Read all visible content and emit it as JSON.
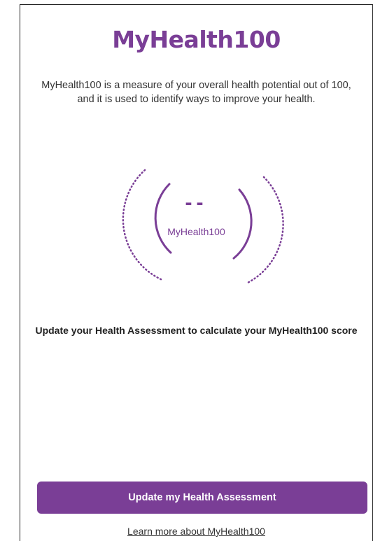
{
  "brand": {
    "title": "MyHealth100",
    "accent": "#7a3e96"
  },
  "intro": {
    "description": "MyHealth100 is a measure of your overall health potential out of 100, and it is used to identify ways to improve your health."
  },
  "score": {
    "value": "--",
    "label": "MyHealth100"
  },
  "prompt": {
    "text": "Update your Health Assessment to calculate your MyHealth100 score"
  },
  "actions": {
    "primary_label": "Update my Health Assessment",
    "learn_more_label": "Learn more about MyHealth100"
  }
}
